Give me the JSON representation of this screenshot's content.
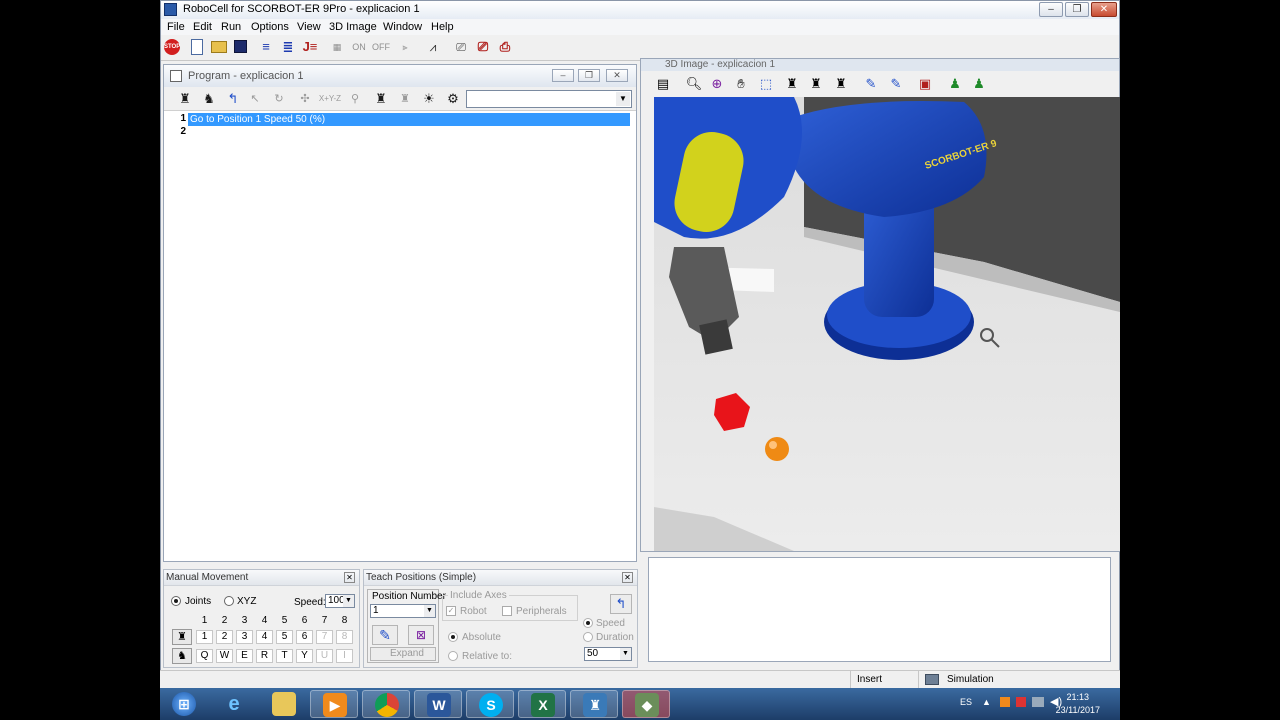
{
  "app": {
    "title": "RoboCell for SCORBOT-ER 9Pro - explicacion 1",
    "minimize": "–",
    "maximize": "❐",
    "close": "✕"
  },
  "menu": [
    "File",
    "Edit",
    "Run",
    "Options",
    "View",
    "3D Image",
    "Window",
    "Help"
  ],
  "toolbar": {
    "stop_label": "STOP",
    "on_label": "ON",
    "off_label": "OFF"
  },
  "program": {
    "title": "Program -  explicacion 1",
    "xyz_label": "X+Y-Z",
    "lines": [
      {
        "num": "1",
        "code": "Go to Position 1 Speed 50 (%)"
      },
      {
        "num": "2",
        "code": ""
      }
    ]
  },
  "view3d": {
    "title": "3D Image - explicacion 1",
    "robot_label": "SCORBOT-ER 9"
  },
  "manual": {
    "title": "Manual Movement",
    "joints_label": "Joints",
    "xyz_label": "XYZ",
    "speed_label": "Speed:",
    "speed_value": "100",
    "axis_numbers": [
      "1",
      "2",
      "3",
      "4",
      "5",
      "6",
      "7",
      "8"
    ],
    "keys_upper": [
      "1",
      "2",
      "3",
      "4",
      "5",
      "6",
      "7",
      "8"
    ],
    "keys_lower": [
      "Q",
      "W",
      "E",
      "R",
      "T",
      "Y",
      "U",
      "I"
    ]
  },
  "teach": {
    "title": "Teach Positions (Simple)",
    "position_number_label": "Position Number",
    "position_value": "1",
    "include_axes_label": "Include Axes",
    "robot_label": "Robot",
    "peripherals_label": "Peripherals",
    "expand_label": "Expand",
    "absolute_label": "Absolute",
    "relative_label": "Relative to:",
    "speed_label": "Speed",
    "duration_label": "Duration",
    "speed_value": "50"
  },
  "status": {
    "insert": "Insert",
    "simulation": "Simulation"
  },
  "taskbar": {
    "lang": "ES",
    "time": "21:13",
    "date": "23/11/2017"
  }
}
